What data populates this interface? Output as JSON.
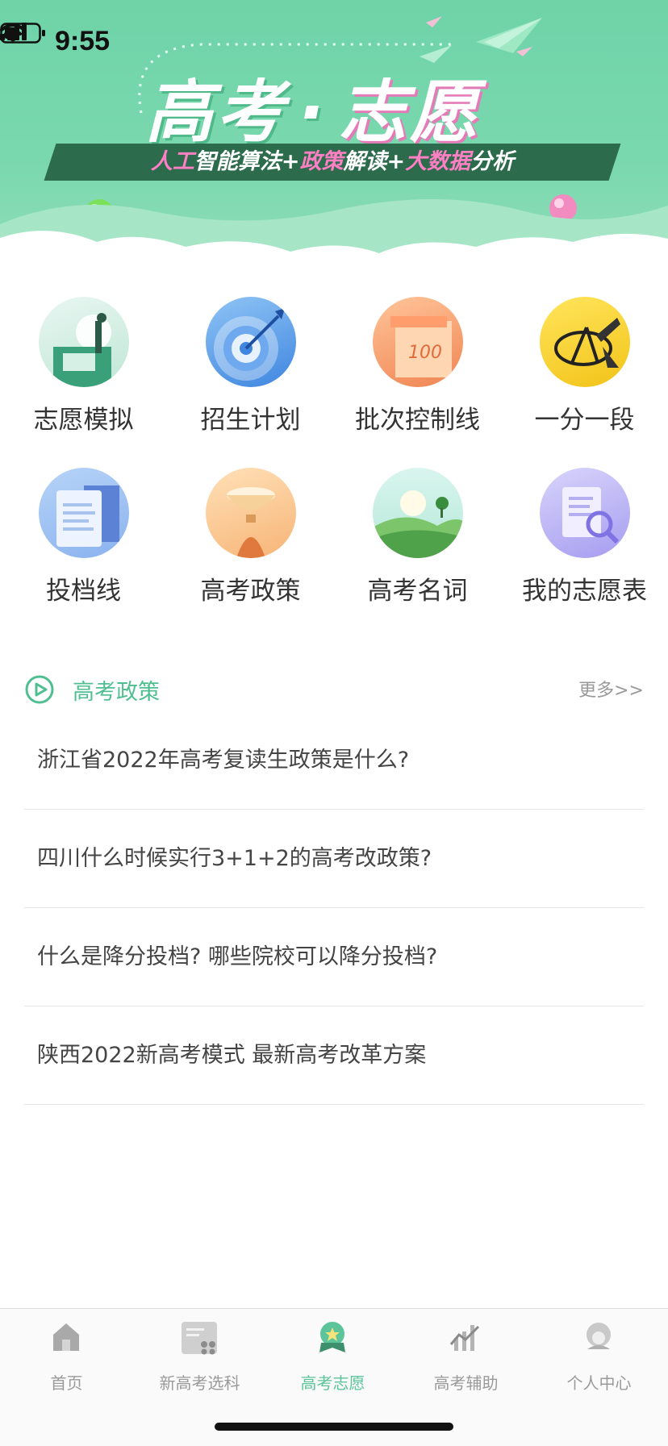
{
  "status_bar": {
    "time": "9:55"
  },
  "banner": {
    "title_left": "高考",
    "title_dot": "·",
    "title_right": "志愿",
    "slogan_parts": [
      "人工",
      "智能算法+",
      "政策",
      "解读+",
      "大数据",
      "分析"
    ]
  },
  "grid": {
    "items": [
      {
        "label": "志愿模拟",
        "icon": "volunteer-simulation-icon"
      },
      {
        "label": "招生计划",
        "icon": "target-icon"
      },
      {
        "label": "批次控制线",
        "icon": "score-100-icon"
      },
      {
        "label": "一分一段",
        "icon": "ruler-compass-icon"
      },
      {
        "label": "投档线",
        "icon": "document-icon"
      },
      {
        "label": "高考政策",
        "icon": "hourglass-icon"
      },
      {
        "label": "高考名词",
        "icon": "landscape-icon"
      },
      {
        "label": "我的志愿表",
        "icon": "search-document-icon"
      }
    ]
  },
  "policy": {
    "title": "高考政策",
    "more": "更多>>",
    "items": [
      "浙江省2022年高考复读生政策是什么?",
      "四川什么时候实行3+1+2的高考改政策?",
      "什么是降分投档? 哪些院校可以降分投档?",
      "陕西2022新高考模式 最新高考改革方案"
    ]
  },
  "tabbar": {
    "active_index": 2,
    "active_color": "#5cc49a",
    "items": [
      {
        "label": "首页",
        "icon": "home-icon"
      },
      {
        "label": "新高考选科",
        "icon": "subject-selection-icon"
      },
      {
        "label": "高考志愿",
        "icon": "medal-icon"
      },
      {
        "label": "高考辅助",
        "icon": "chart-icon"
      },
      {
        "label": "个人中心",
        "icon": "user-icon"
      }
    ]
  }
}
